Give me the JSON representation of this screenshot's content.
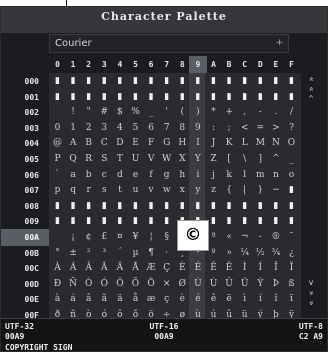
{
  "title": "Character Palette",
  "font": "Courier",
  "font_dropdown_icon": "dropdown-arrow-icon",
  "columns": [
    "0",
    "1",
    "2",
    "3",
    "4",
    "5",
    "6",
    "7",
    "8",
    "9",
    "A",
    "B",
    "C",
    "D",
    "E",
    "F"
  ],
  "rows": [
    "000",
    "001",
    "002",
    "003",
    "004",
    "005",
    "006",
    "007",
    "008",
    "009",
    "00A",
    "00B",
    "00C",
    "00D",
    "00E",
    "00F"
  ],
  "selected": {
    "row": 10,
    "col": 9
  },
  "cells": [
    [
      "▮",
      "▮",
      "▮",
      "▮",
      "▮",
      "▮",
      "▮",
      "▮",
      "▮",
      "▮",
      "▮",
      "▮",
      "▮",
      "▮",
      "▮",
      "▮"
    ],
    [
      "▮",
      "▮",
      "▮",
      "▮",
      "▮",
      "▮",
      "▮",
      "▮",
      "▮",
      "▮",
      "▮",
      "▮",
      "▮",
      "▮",
      "▮",
      "▮"
    ],
    [
      "",
      "!",
      "\"",
      "#",
      "$",
      "%",
      "_",
      "'",
      "(",
      ")",
      "*",
      "+",
      ",",
      "-",
      ".",
      "/"
    ],
    [
      "0",
      "1",
      "2",
      "3",
      "4",
      "5",
      "6",
      "7",
      "8",
      "9",
      ":",
      ";",
      "<",
      "=",
      ">",
      "?"
    ],
    [
      "@",
      "A",
      "B",
      "C",
      "D",
      "E",
      "F",
      "G",
      "H",
      "I",
      "J",
      "K",
      "L",
      "M",
      "N",
      "O"
    ],
    [
      "P",
      "Q",
      "R",
      "S",
      "T",
      "U",
      "V",
      "W",
      "X",
      "Y",
      "Z",
      "[",
      "\\",
      "]",
      "^",
      "_"
    ],
    [
      "`",
      "a",
      "b",
      "c",
      "d",
      "e",
      "f",
      "g",
      "h",
      "i",
      "j",
      "k",
      "l",
      "m",
      "n",
      "o"
    ],
    [
      "p",
      "q",
      "r",
      "s",
      "t",
      "u",
      "v",
      "w",
      "x",
      "y",
      "z",
      "{",
      "|",
      "}",
      "~",
      "▮"
    ],
    [
      "▮",
      "▮",
      "▮",
      "▮",
      "▮",
      "▮",
      "▮",
      "▮",
      "▮",
      "▮",
      "▮",
      "▮",
      "▮",
      "▮",
      "▮",
      "▮"
    ],
    [
      "▮",
      "▮",
      "▮",
      "▮",
      "▮",
      "▮",
      "▮",
      "▮",
      "▮",
      "▮",
      "▮",
      "▮",
      "▮",
      "▮",
      "▮",
      "▮"
    ],
    [
      "",
      "¡",
      "¢",
      "£",
      "¤",
      "¥",
      "¦",
      "§",
      "¨",
      "©",
      "ª",
      "«",
      "¬",
      "-",
      "®",
      "¯"
    ],
    [
      "°",
      "±",
      "²",
      "³",
      "´",
      "µ",
      "¶",
      "·",
      "¸",
      "¹",
      "º",
      "»",
      "¼",
      "½",
      "¾",
      "¿"
    ],
    [
      "À",
      "Á",
      "Â",
      "Ã",
      "Ä",
      "Å",
      "Æ",
      "Ç",
      "È",
      "É",
      "Ê",
      "Ë",
      "Ì",
      "Í",
      "Î",
      "Ï"
    ],
    [
      "Ð",
      "Ñ",
      "Ò",
      "Ó",
      "Ô",
      "Õ",
      "Ö",
      "×",
      "Ø",
      "Ù",
      "Ú",
      "Û",
      "Ü",
      "Ý",
      "Þ",
      "ß"
    ],
    [
      "à",
      "á",
      "â",
      "ã",
      "ä",
      "å",
      "æ",
      "ç",
      "è",
      "é",
      "ê",
      "ë",
      "ì",
      "í",
      "î",
      "ï"
    ],
    [
      "ð",
      "ñ",
      "ò",
      "ó",
      "ô",
      "õ",
      "ö",
      "÷",
      "ø",
      "ù",
      "ú",
      "û",
      "ü",
      "ý",
      "þ",
      "ÿ"
    ]
  ],
  "scroll": {
    "top": [
      "«",
      "«",
      "^"
    ],
    "bottom": [
      "v",
      "»",
      "»"
    ]
  },
  "info": {
    "utf32_label": "UTF-32",
    "utf16_label": "UTF-16",
    "utf8_label": "UTF-8",
    "utf32_value": "00A9",
    "utf16_value": "00A9",
    "utf8_value": "C2 A9",
    "name": "COPYRIGHT SIGN"
  },
  "colors": {
    "window_bg": "#1b1c1f",
    "cell_bg": "#2a2b2f",
    "selected_bg": "#ffffff",
    "header_sel": "#5a5d63"
  }
}
